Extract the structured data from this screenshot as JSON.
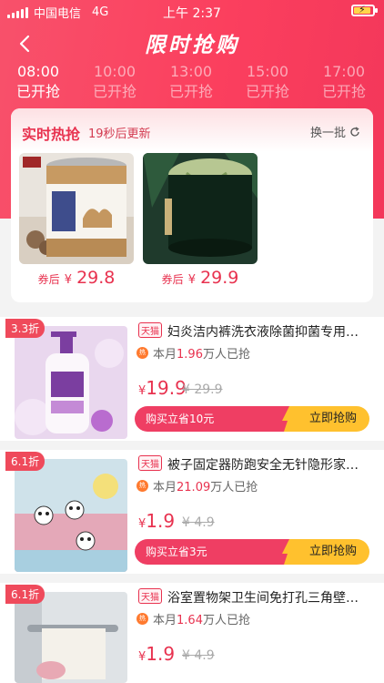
{
  "status": {
    "carrier": "中国电信",
    "network": "4G",
    "time": "上午 2:37"
  },
  "nav": {
    "title": "限时抢购"
  },
  "tabs": [
    {
      "time": "08:00",
      "status": "已开抢",
      "active": true
    },
    {
      "time": "10:00",
      "status": "已开抢",
      "active": false
    },
    {
      "time": "13:00",
      "status": "已开抢",
      "active": false
    },
    {
      "time": "15:00",
      "status": "已开抢",
      "active": false
    },
    {
      "time": "17:00",
      "status": "已开抢",
      "active": false
    }
  ],
  "hot": {
    "title": "实时热抢",
    "subtitle": "19秒后更新",
    "swap_label": "换一批",
    "items": [
      {
        "label": "券后",
        "currency": "¥",
        "price": "29.8"
      },
      {
        "label": "券后",
        "currency": "¥",
        "price": "29.9"
      }
    ]
  },
  "products": [
    {
      "discount": "3.3折",
      "tag": "天猫",
      "title": "妇炎洁内裤洗衣液除菌抑菌专用内裤清洗剂",
      "sold_prefix": "本月",
      "sold_num": "1.96",
      "sold_suffix": "万人已抢",
      "currency": "¥",
      "price": "19.9",
      "orig_price": "¥ 29.9",
      "save_label": "购买立省10元",
      "grab_label": "立即抢购"
    },
    {
      "discount": "6.1折",
      "tag": "天猫",
      "title": "被子固定器防跑安全无针隐形家用被角固定",
      "sold_prefix": "本月",
      "sold_num": "21.09",
      "sold_suffix": "万人已抢",
      "currency": "¥",
      "price": "1.9",
      "orig_price": "¥ 4.9",
      "save_label": "购买立省3元",
      "grab_label": "立即抢购"
    },
    {
      "discount": "6.1折",
      "tag": "天猫",
      "title": "浴室置物架卫生间免打孔三角壁挂收纳架",
      "sold_prefix": "本月",
      "sold_num": "1.64",
      "sold_suffix": "万人已抢",
      "currency": "¥",
      "price": "1.9",
      "orig_price": "¥ 4.9",
      "save_label": "购买立省3元",
      "grab_label": "立即抢购"
    }
  ],
  "colors": {
    "brand": "#fb3f5e",
    "price": "#e8324f",
    "button_left": "#ef3e63",
    "button_right": "#ffc12e"
  }
}
